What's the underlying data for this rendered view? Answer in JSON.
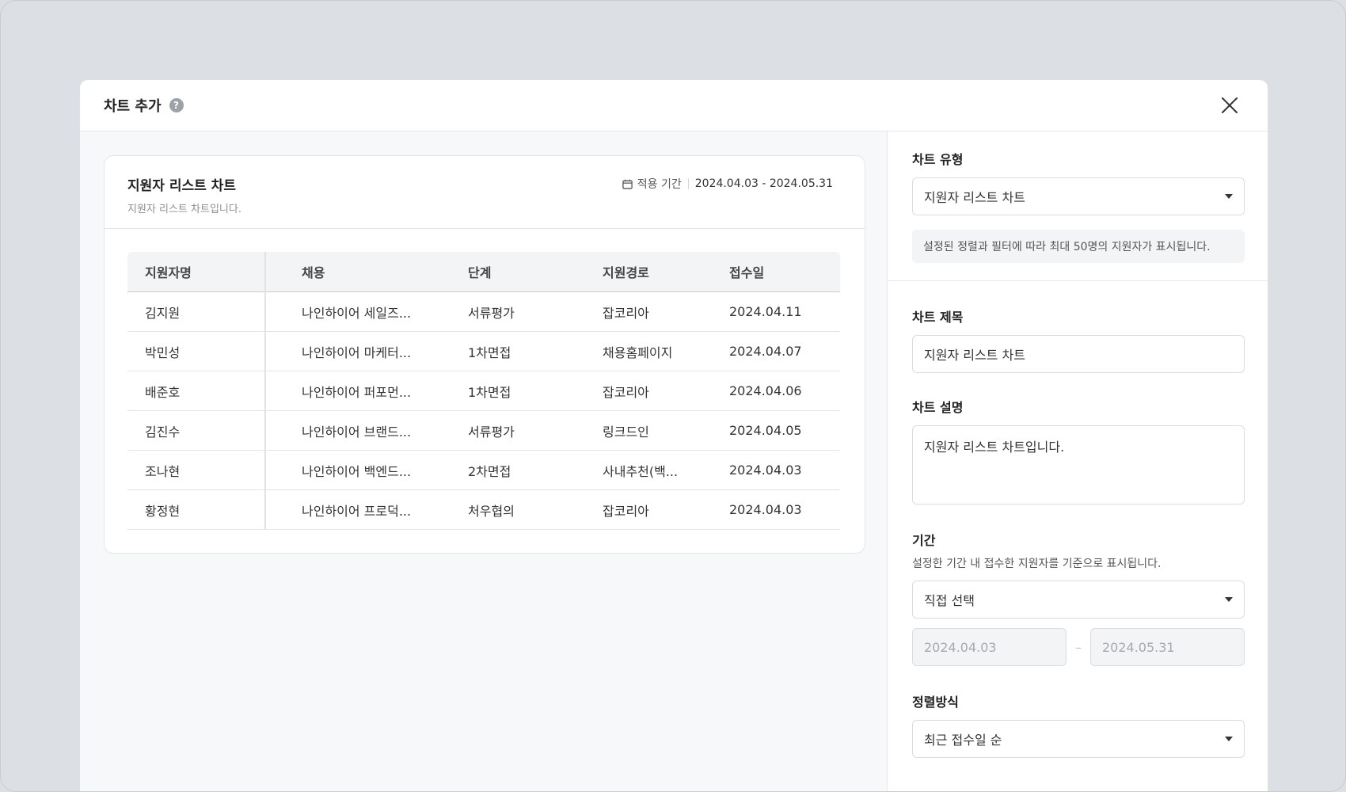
{
  "modal": {
    "title": "차트 추가",
    "help_icon": "help-icon",
    "close_icon": "close-icon"
  },
  "preview": {
    "title": "지원자 리스트 차트",
    "description": "지원자 리스트 차트입니다.",
    "period_label": "적용 기간",
    "period_range": "2024.04.03 - 2024.05.31",
    "table": {
      "headers": [
        "지원자명",
        "채용",
        "단계",
        "지원경로",
        "접수일"
      ],
      "rows": [
        [
          "김지원",
          "나인하이어 세일즈...",
          "서류평가",
          "잡코리아",
          "2024.04.11"
        ],
        [
          "박민성",
          "나인하이어 마케터...",
          "1차면접",
          "채용홈페이지",
          "2024.04.07"
        ],
        [
          "배준호",
          "나인하이어 퍼포먼...",
          "1차면접",
          "잡코리아",
          "2024.04.06"
        ],
        [
          "김진수",
          "나인하이어 브랜드...",
          "서류평가",
          "링크드인",
          "2024.04.05"
        ],
        [
          "조나현",
          "나인하이어 백엔드...",
          "2차면접",
          "사내추천(백...",
          "2024.04.03"
        ],
        [
          "황정현",
          "나인하이어 프로덕...",
          "처우협의",
          "잡코리아",
          "2024.04.03"
        ]
      ]
    }
  },
  "settings": {
    "chart_type": {
      "label": "차트 유형",
      "value": "지원자 리스트 차트",
      "info": "설정된 정렬과 필터에 따라 최대 50명의 지원자가 표시됩니다."
    },
    "chart_title": {
      "label": "차트 제목",
      "value": "지원자 리스트 차트"
    },
    "chart_desc": {
      "label": "차트 설명",
      "value": "지원자 리스트 차트입니다."
    },
    "period": {
      "label": "기간",
      "sub": "설정한 기간 내 접수한 지원자를 기준으로 표시됩니다.",
      "value": "직접 선택",
      "start": "2024.04.03",
      "end": "2024.05.31",
      "dash": "–"
    },
    "sort": {
      "label": "정렬방식",
      "value": "최근 접수일 순"
    }
  }
}
